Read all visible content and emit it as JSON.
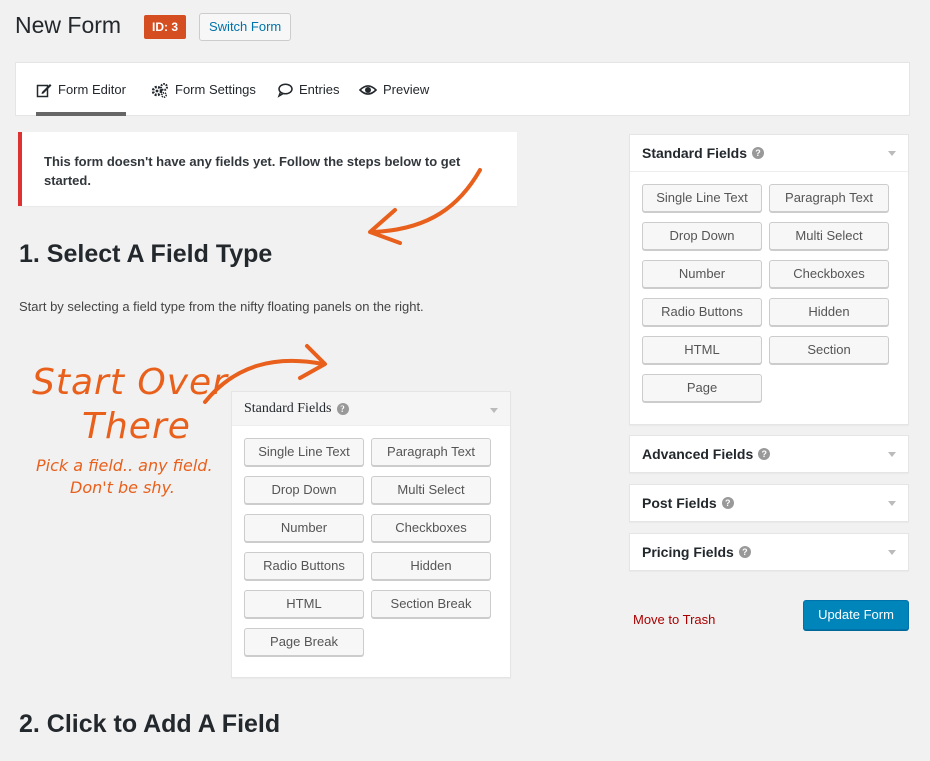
{
  "header": {
    "title": "New Form",
    "id_badge": "ID: 3",
    "switch_label": "Switch Form"
  },
  "tabs": [
    {
      "label": "Form Editor",
      "icon": "edit-icon",
      "active": true
    },
    {
      "label": "Form Settings",
      "icon": "gears-icon",
      "active": false
    },
    {
      "label": "Entries",
      "icon": "comment-icon",
      "active": false
    },
    {
      "label": "Preview",
      "icon": "eye-icon",
      "active": false
    }
  ],
  "notice": {
    "text": "This form doesn't have any fields yet. Follow the steps below to get started."
  },
  "steps": {
    "step1_title": "1. Select A Field Type",
    "step1_desc": "Start by selecting a field type from the nifty floating panels on the right.",
    "step2_title": "2. Click to Add A Field"
  },
  "handwriting": {
    "line1": "Start Over",
    "line2": "There",
    "line3": "Pick a field.. any field.",
    "line4": "Don't be shy."
  },
  "illustration_panel": {
    "title": "Standard Fields",
    "buttons": [
      "Single Line Text",
      "Paragraph Text",
      "Drop Down",
      "Multi Select",
      "Number",
      "Checkboxes",
      "Radio Buttons",
      "Hidden",
      "HTML",
      "Section Break",
      "Page Break"
    ]
  },
  "sidebar": {
    "standard": {
      "title": "Standard Fields",
      "buttons": [
        "Single Line Text",
        "Paragraph Text",
        "Drop Down",
        "Multi Select",
        "Number",
        "Checkboxes",
        "Radio Buttons",
        "Hidden",
        "HTML",
        "Section",
        "Page"
      ]
    },
    "advanced_title": "Advanced Fields",
    "post_title": "Post Fields",
    "pricing_title": "Pricing Fields"
  },
  "actions": {
    "trash_label": "Move to Trash",
    "update_label": "Update Form"
  },
  "colors": {
    "accent": "#0085ba",
    "badge": "#d54e21",
    "handwriting": "#e8601c",
    "notice_border": "#dc3232"
  }
}
